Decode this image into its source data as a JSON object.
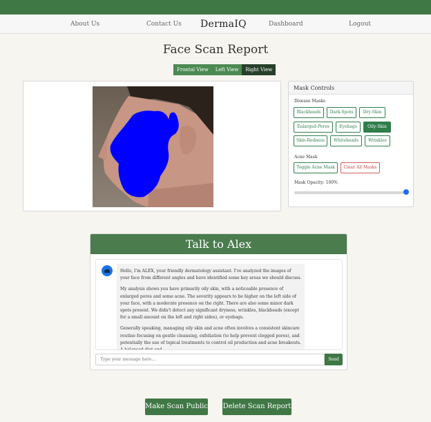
{
  "nav": {
    "about": "About Us",
    "contact": "Contact Us",
    "brand": "DermaIQ",
    "dashboard": "Dashboard",
    "logout": "Logout"
  },
  "page_title": "Face Scan Report",
  "view_tabs": [
    {
      "label": "Frontal View",
      "active": false
    },
    {
      "label": "Left View",
      "active": false
    },
    {
      "label": "Right View",
      "active": true
    }
  ],
  "scan": {
    "mask_color": "#0000ff"
  },
  "mask_controls": {
    "title": "Mask Controls",
    "disease_label": "Disease Masks",
    "disease_buttons": [
      {
        "label": "Blackheads",
        "active": false
      },
      {
        "label": "Dark-Spots",
        "active": false
      },
      {
        "label": "Dry-Skin",
        "active": false
      },
      {
        "label": "Enlarged-Pores",
        "active": false
      },
      {
        "label": "Eyebags",
        "active": false
      },
      {
        "label": "Oily-Skin",
        "active": true
      },
      {
        "label": "Skin-Redness",
        "active": false
      },
      {
        "label": "Whiteheads",
        "active": false
      },
      {
        "label": "Wrinkles",
        "active": false
      }
    ],
    "acne_label": "Acne Mask",
    "toggle_acne": "Toggle Acne Mask",
    "clear_all": "Clear All Masks",
    "opacity_label": "Mask Opacity: 100%",
    "opacity_value": 1.0
  },
  "chat": {
    "title": "Talk to Alex",
    "messages": [
      "Hello, I'm ALEX, your friendly dermatology assistant. I've analyzed the images of your face from different angles and have identified some key areas we should discuss.",
      "My analysis shows you have primarily oily skin, with a noticeable presence of enlarged pores and some acne. The severity appears to be higher on the left side of your face, with a moderate presence on the right. There are also some minor dark spots present. We didn't detect any significant dryness, wrinkles, blackheads (except for a small amount on the left and right sides), or eyebags.",
      "Generally speaking, managing oily skin and acne often involves a consistent skincare routine focusing on gentle cleansing, exfoliation (to help prevent clogged pores), and potentially the use of topical treatments to control oil production and acne breakouts. A balanced diet and"
    ],
    "input_placeholder": "Type your message here...",
    "send_label": "Send"
  },
  "actions": {
    "make_public": "Make Scan Public",
    "delete_report": "Delete Scan Report"
  },
  "colors": {
    "primary_green": "#3f7745",
    "active_tab": "#27402a",
    "accent_blue": "#1a73e8",
    "danger_red": "#c94444"
  }
}
